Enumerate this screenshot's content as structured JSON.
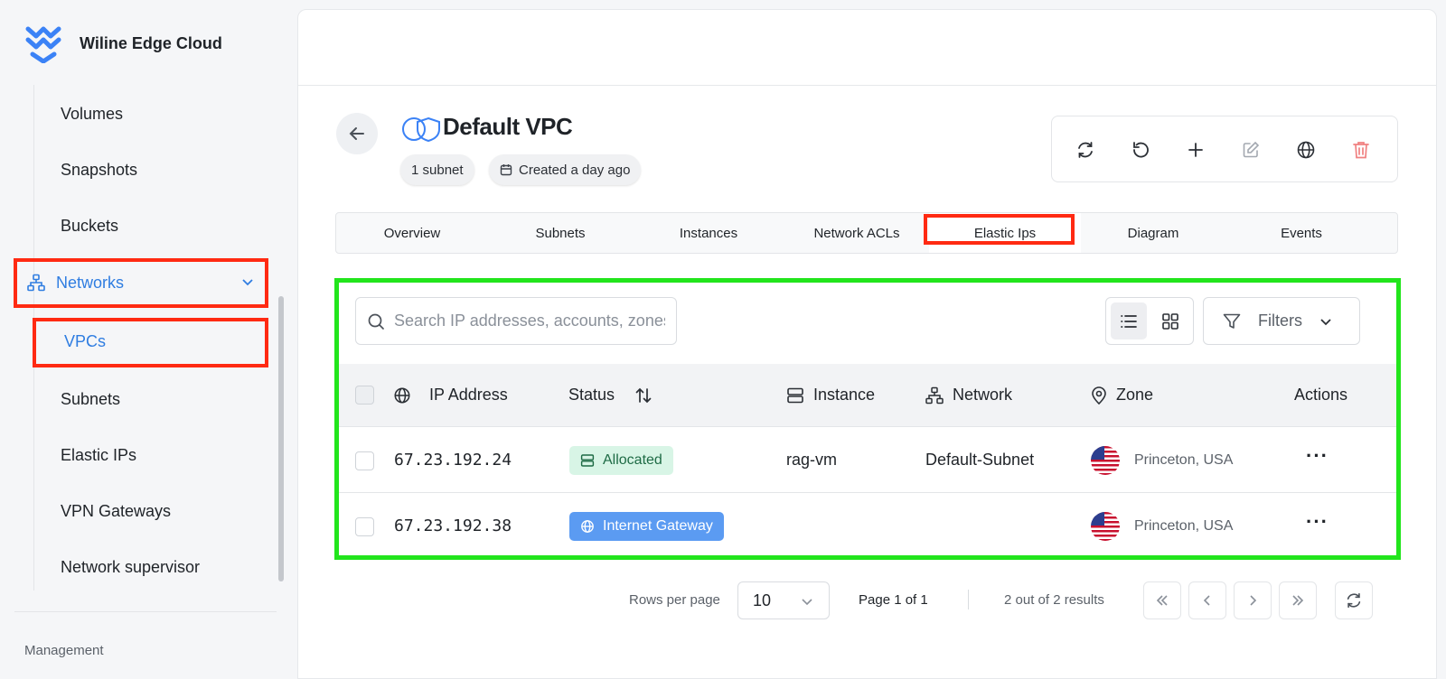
{
  "app": {
    "name": "Wiline Edge Cloud"
  },
  "sidebar": {
    "items": [
      {
        "label": "Volumes"
      },
      {
        "label": "Snapshots"
      },
      {
        "label": "Buckets"
      },
      {
        "label": "Networks"
      },
      {
        "label": "VPCs"
      },
      {
        "label": "Subnets"
      },
      {
        "label": "Elastic IPs"
      },
      {
        "label": "VPN Gateways"
      },
      {
        "label": "Network supervisor"
      }
    ],
    "section": "Management"
  },
  "header": {
    "title": "Default VPC",
    "subnet_chip": "1 subnet",
    "created_chip": "Created a day ago"
  },
  "tabs": [
    {
      "label": "Overview"
    },
    {
      "label": "Subnets"
    },
    {
      "label": "Instances"
    },
    {
      "label": "Network ACLs"
    },
    {
      "label": "Elastic Ips"
    },
    {
      "label": "Diagram"
    },
    {
      "label": "Events"
    }
  ],
  "search": {
    "placeholder": "Search IP addresses, accounts, zones..."
  },
  "filters_label": "Filters",
  "table": {
    "columns": [
      "IP Address",
      "Status",
      "Instance",
      "Network",
      "Zone",
      "Actions"
    ],
    "rows": [
      {
        "ip": "67.23.192.24",
        "status": "Allocated",
        "instance": "rag-vm",
        "network": "Default-Subnet",
        "zone": "Princeton, USA"
      },
      {
        "ip": "67.23.192.38",
        "status": "Internet Gateway",
        "instance": "",
        "network": "",
        "zone": "Princeton, USA"
      }
    ]
  },
  "pagination": {
    "rows_per_page_label": "Rows per page",
    "rows_per_page": "10",
    "page_info": "Page 1 of 1",
    "results": "2 out of 2 results"
  },
  "colors": {
    "accent": "#2f7de1",
    "highlight_red": "#ff2a12",
    "highlight_green": "#22e51c",
    "allocated_bg": "#d8f5e6",
    "gateway_bg": "#5b9bf2"
  }
}
